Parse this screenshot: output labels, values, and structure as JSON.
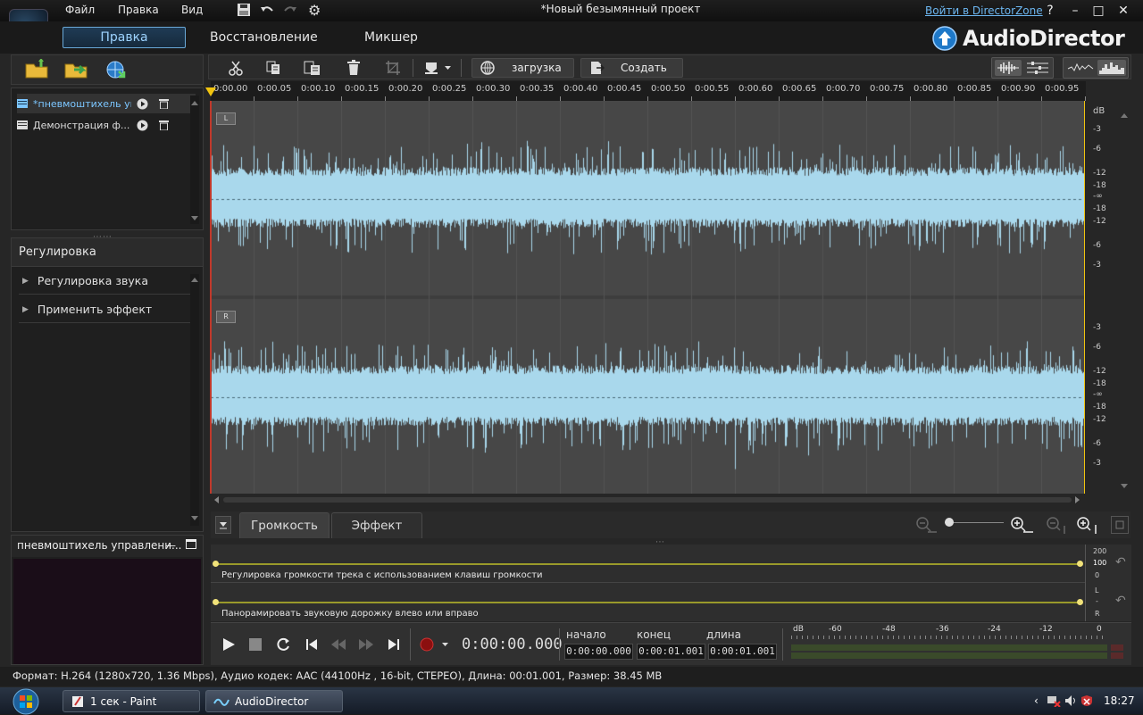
{
  "menu": {
    "file": "Файл",
    "edit": "Правка",
    "view": "Вид"
  },
  "window": {
    "title": "*Новый безымянный проект",
    "directorzone_link": "Войти в DirectorZone",
    "help": "?",
    "minimize": "–",
    "maximize": "□",
    "close": "✕"
  },
  "modes": {
    "edit": "Правка",
    "restore": "Восстановление",
    "mixer": "Микшер"
  },
  "brand": {
    "name": "AudioDirector"
  },
  "library": {
    "items": [
      {
        "name": "*пневмоштихель управления",
        "selected": true
      },
      {
        "name": "Демонстрация ф...",
        "selected": false
      }
    ]
  },
  "adjust": {
    "title": "Регулировка",
    "items": [
      "Регулировка звука",
      "Применить эффект"
    ]
  },
  "preview": {
    "title": "пневмоштихель управлени..."
  },
  "toolbar": {
    "upload": "загрузка",
    "create": "Создать"
  },
  "ruler": {
    "ticks": [
      "0:00.00",
      "0:00.05",
      "0:00.10",
      "0:00.15",
      "0:00.20",
      "0:00.25",
      "0:00.30",
      "0:00.35",
      "0:00.40",
      "0:00.45",
      "0:00.50",
      "0:00.55",
      "0:00.60",
      "0:00.65",
      "0:00.70",
      "0:00.75",
      "0:00.80",
      "0:00.85",
      "0:00.90",
      "0:00.95"
    ]
  },
  "channels": {
    "left": "L",
    "right": "R"
  },
  "db_scale": {
    "unit": "dB",
    "left": [
      "-3",
      "-6",
      "-12",
      "-18",
      "-∞",
      "-18",
      "-12",
      "-6",
      "-3"
    ],
    "right": [
      "-3",
      "-6",
      "-12",
      "-18",
      "-∞",
      "-18",
      "-12",
      "-6",
      "-3"
    ]
  },
  "lower_tabs": {
    "volume": "Громкость",
    "effect": "Эффект"
  },
  "envelopes": {
    "volume_desc": "Регулировка громкости трека с использованием клавиш громкости",
    "pan_desc": "Панорамировать звуковую дорожку влево или вправо",
    "volume_scale": [
      "200",
      "100",
      "0"
    ],
    "pan_scale": [
      "L",
      "-",
      "R"
    ]
  },
  "transport": {
    "timecode": "0:00:00.000",
    "start_label": "начало",
    "end_label": "конец",
    "length_label": "длина",
    "start_value": "0:00:00.000",
    "end_value": "0:00:01.001",
    "length_value": "0:00:01.001"
  },
  "meter": {
    "unit": "dB",
    "ticks": [
      "-60",
      "-48",
      "-36",
      "-24",
      "-12",
      "0"
    ]
  },
  "status": "Формат: H.264 (1280x720, 1.36 Mbps), Аудио кодек: AAC (44100Hz , 16-bit, СТЕРЕО), Длина: 00:01.001, Размер: 38.45 MB",
  "taskbar": {
    "paint": "1 сек - Paint",
    "audiodirector": "AudioDirector",
    "clock": "18:27"
  },
  "colors": {
    "waveform": "#a9d8ec",
    "accent": "#6aa9d8",
    "background": "#262626"
  }
}
